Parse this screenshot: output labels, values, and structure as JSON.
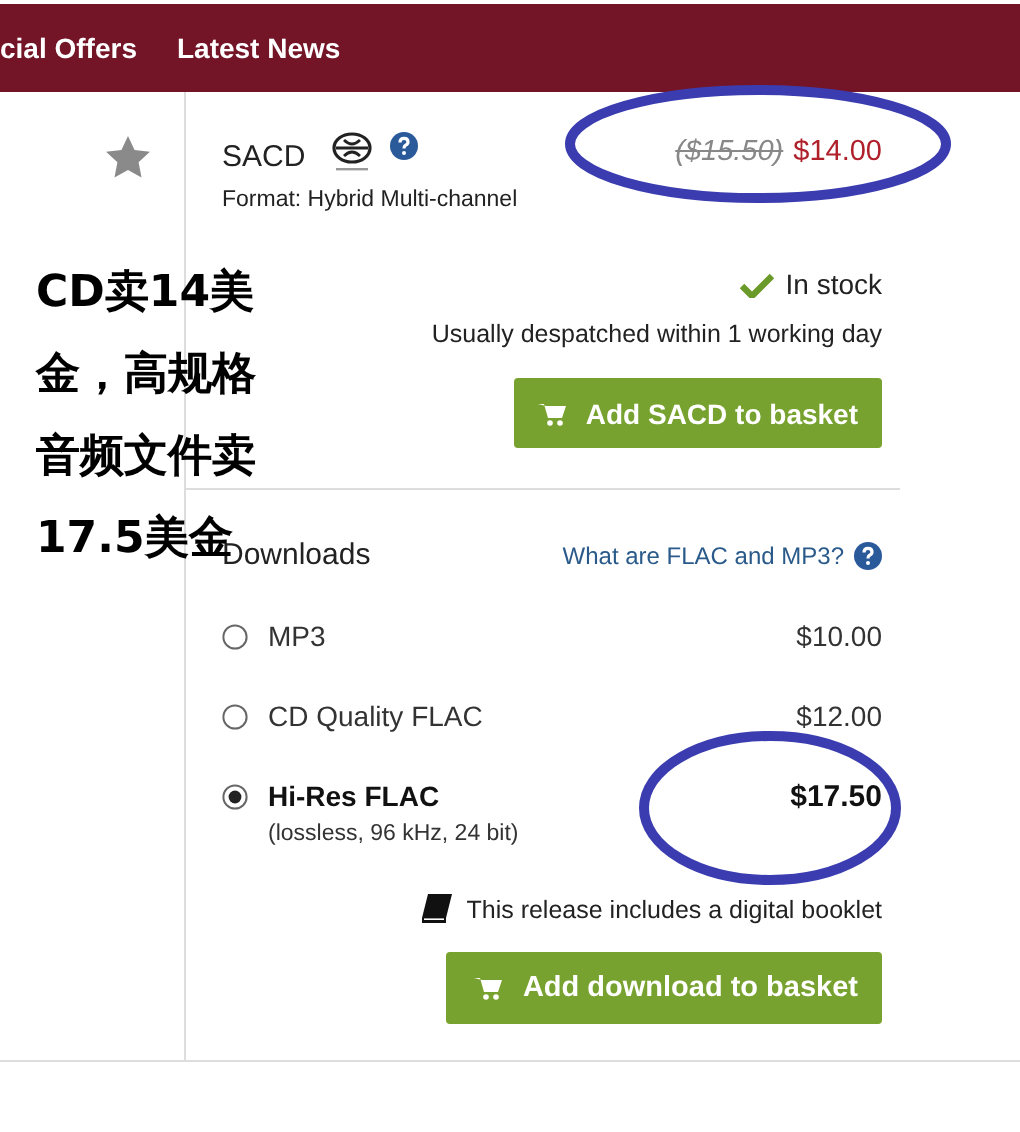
{
  "nav": {
    "items": [
      "cial Offers",
      "Latest News"
    ]
  },
  "format": {
    "name": "SACD",
    "note": "Format: Hybrid Multi-channel",
    "old_price": "($15.50)",
    "price": "$14.00",
    "stock": "In stock",
    "despatch": "Usually despatched within 1 working day",
    "button": "Add SACD to basket"
  },
  "downloads": {
    "title": "Downloads",
    "help_link": "What are FLAC and MP3?",
    "options": [
      {
        "name": "MP3",
        "price": "$10.00",
        "selected": false
      },
      {
        "name": "CD Quality FLAC",
        "price": "$12.00",
        "selected": false
      },
      {
        "name": "Hi-Res FLAC",
        "detail": "(lossless, 96 kHz, 24 bit)",
        "price": "$17.50",
        "selected": true
      }
    ],
    "booklet": "This release includes a digital booklet",
    "button": "Add download to basket"
  },
  "annotation": {
    "lines": [
      "CD卖14美",
      "金，高规格",
      "音频文件卖",
      "17.5美金"
    ]
  }
}
